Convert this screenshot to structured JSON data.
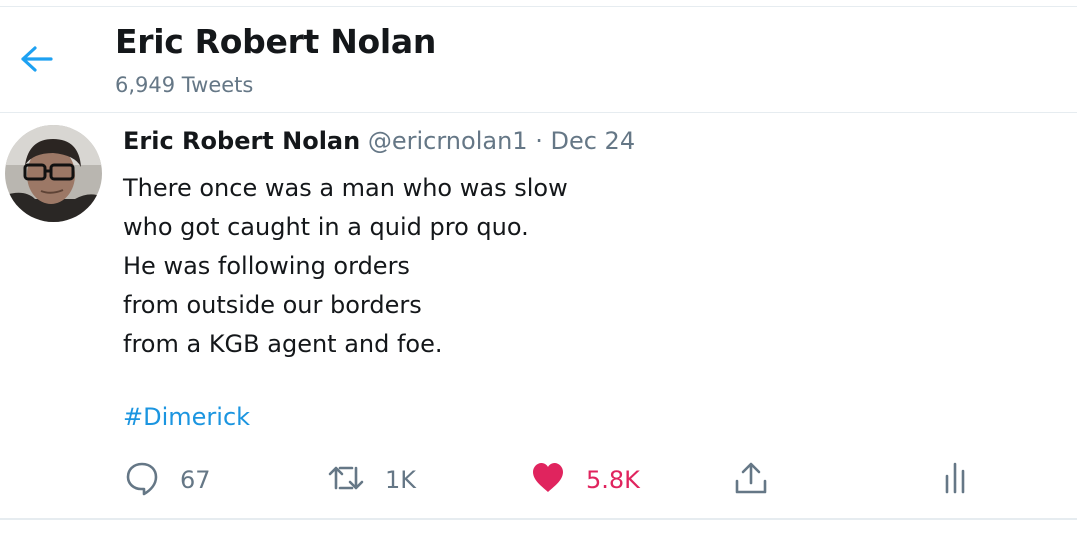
{
  "header": {
    "back_icon": "arrow-left-icon",
    "title": "Eric Robert Nolan",
    "tweet_count": "6,949 Tweets"
  },
  "tweet": {
    "author_name": "Eric Robert Nolan",
    "handle": "@ericrnolan1",
    "separator": "·",
    "date": "Dec 24",
    "lines": [
      "There once was a man who was slow",
      "who got caught in a quid pro quo.",
      "He was following orders",
      "from outside our borders",
      "from a KGB agent and foe."
    ],
    "hashtag": "#Dimerick",
    "actions": {
      "reply_icon": "speech-bubble-icon",
      "reply_count": "67",
      "retweet_icon": "retweet-icon",
      "retweet_count": "1K",
      "like_icon": "heart-icon",
      "like_count": "5.8K",
      "share_icon": "share-icon",
      "analytics_icon": "analytics-icon"
    }
  },
  "colors": {
    "accent": "#1da1f2",
    "hashtag": "#1b95e0",
    "like": "#e0245e",
    "muted": "#657786",
    "text": "#14171a",
    "divider": "#e6ecf0"
  }
}
